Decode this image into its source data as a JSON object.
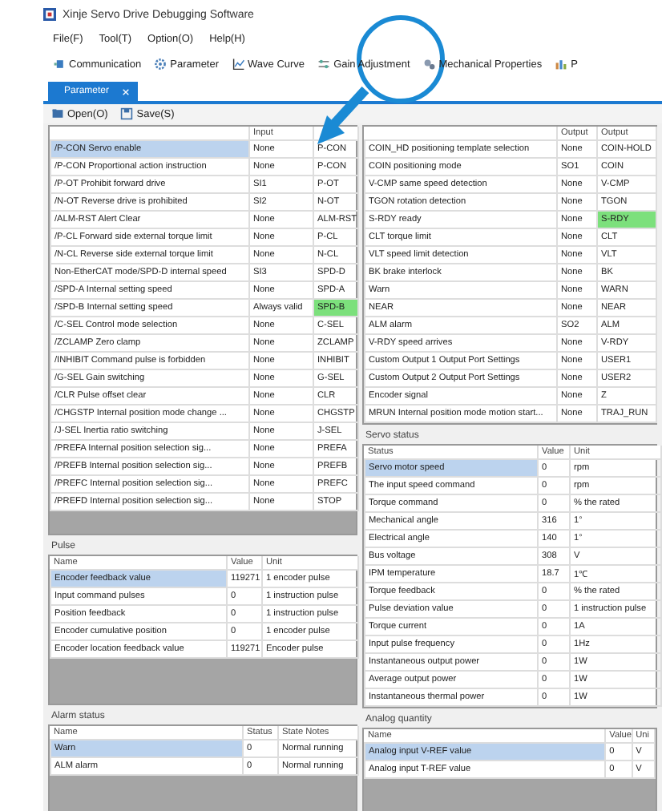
{
  "window": {
    "title": "Xinje Servo Drive Debugging Software"
  },
  "menu": [
    "File(F)",
    "Tool(T)",
    "Option(O)",
    "Help(H)"
  ],
  "toolbar": [
    {
      "kind": "plug",
      "label": "Communication"
    },
    {
      "kind": "gear",
      "label": "Parameter"
    },
    {
      "kind": "wave",
      "label": "Wave Curve"
    },
    {
      "kind": "tune",
      "label": "Gain Adjustment"
    },
    {
      "kind": "mech",
      "label": "Mechanical Properties"
    },
    {
      "kind": "bars",
      "label": "P"
    }
  ],
  "tabs": [
    {
      "label": "Parameter",
      "selected": true
    }
  ],
  "actions": [
    {
      "kind": "open",
      "label": "Open(O)"
    },
    {
      "kind": "save",
      "label": "Save(S)"
    }
  ],
  "input_signals": {
    "columns": [
      "",
      "Input",
      ""
    ],
    "rows": [
      {
        "cells": [
          "/P-CON Servo enable",
          "None",
          "P-CON"
        ],
        "selected": true,
        "signal_on": false
      },
      {
        "cells": [
          "/P-CON Proportional action instruction",
          "None",
          "P-CON"
        ],
        "selected": false,
        "signal_on": false
      },
      {
        "cells": [
          "/P-OT Prohibit forward drive",
          "SI1",
          "P-OT"
        ],
        "selected": false,
        "signal_on": false
      },
      {
        "cells": [
          "/N-OT Reverse drive is prohibited",
          "SI2",
          "N-OT"
        ],
        "selected": false,
        "signal_on": false
      },
      {
        "cells": [
          "/ALM-RST Alert Clear",
          "None",
          "ALM-RST"
        ],
        "selected": false,
        "signal_on": false
      },
      {
        "cells": [
          "/P-CL Forward side external torque limit",
          "None",
          "P-CL"
        ],
        "selected": false,
        "signal_on": false
      },
      {
        "cells": [
          "/N-CL Reverse side external torque limit",
          "None",
          "N-CL"
        ],
        "selected": false,
        "signal_on": false
      },
      {
        "cells": [
          "Non-EtherCAT mode/SPD-D internal speed",
          "SI3",
          "SPD-D"
        ],
        "selected": false,
        "signal_on": false
      },
      {
        "cells": [
          "/SPD-A Internal setting speed",
          "None",
          "SPD-A"
        ],
        "selected": false,
        "signal_on": false
      },
      {
        "cells": [
          "/SPD-B Internal setting speed",
          "Always valid",
          "SPD-B"
        ],
        "selected": false,
        "signal_on": true
      },
      {
        "cells": [
          "/C-SEL Control mode selection",
          "None",
          "C-SEL"
        ],
        "selected": false,
        "signal_on": false
      },
      {
        "cells": [
          "/ZCLAMP Zero clamp",
          "None",
          "ZCLAMP"
        ],
        "selected": false,
        "signal_on": false
      },
      {
        "cells": [
          "/INHIBIT Command pulse is forbidden",
          "None",
          "INHIBIT"
        ],
        "selected": false,
        "signal_on": false
      },
      {
        "cells": [
          "/G-SEL Gain switching",
          "None",
          "G-SEL"
        ],
        "selected": false,
        "signal_on": false
      },
      {
        "cells": [
          "/CLR Pulse offset clear",
          "None",
          "CLR"
        ],
        "selected": false,
        "signal_on": false
      },
      {
        "cells": [
          "/CHGSTP Internal position mode change ...",
          "None",
          "CHGSTP"
        ],
        "selected": false,
        "signal_on": false
      },
      {
        "cells": [
          "/J-SEL Inertia ratio switching",
          "None",
          "J-SEL"
        ],
        "selected": false,
        "signal_on": false
      },
      {
        "cells": [
          "/PREFA Internal position selection sig...",
          "None",
          "PREFA"
        ],
        "selected": false,
        "signal_on": false
      },
      {
        "cells": [
          "/PREFB Internal position selection sig...",
          "None",
          "PREFB"
        ],
        "selected": false,
        "signal_on": false
      },
      {
        "cells": [
          "/PREFC Internal position selection sig...",
          "None",
          "PREFC"
        ],
        "selected": false,
        "signal_on": false
      },
      {
        "cells": [
          "/PREFD Internal position selection sig...",
          "None",
          "STOP"
        ],
        "selected": false,
        "signal_on": false
      }
    ]
  },
  "output_signals": {
    "columns": [
      "",
      "Output",
      "Output"
    ],
    "rows": [
      {
        "cells": [
          "COIN_HD positioning template selection",
          "None",
          "COIN-HOLD"
        ],
        "selected": false,
        "signal_on": false
      },
      {
        "cells": [
          "COIN positioning mode",
          "SO1",
          "COIN"
        ],
        "selected": false,
        "signal_on": false
      },
      {
        "cells": [
          "V-CMP same speed detection",
          "None",
          "V-CMP"
        ],
        "selected": false,
        "signal_on": false
      },
      {
        "cells": [
          "TGON rotation detection",
          "None",
          "TGON"
        ],
        "selected": false,
        "signal_on": false
      },
      {
        "cells": [
          "S-RDY ready",
          "None",
          "S-RDY"
        ],
        "selected": false,
        "signal_on": true
      },
      {
        "cells": [
          "CLT torque limit",
          "None",
          "CLT"
        ],
        "selected": false,
        "signal_on": false
      },
      {
        "cells": [
          "VLT speed limit detection",
          "None",
          "VLT"
        ],
        "selected": false,
        "signal_on": false
      },
      {
        "cells": [
          "BK brake interlock",
          "None",
          "BK"
        ],
        "selected": false,
        "signal_on": false
      },
      {
        "cells": [
          "Warn",
          "None",
          "WARN"
        ],
        "selected": false,
        "signal_on": false
      },
      {
        "cells": [
          "NEAR",
          "None",
          "NEAR"
        ],
        "selected": false,
        "signal_on": false
      },
      {
        "cells": [
          "ALM alarm",
          "SO2",
          "ALM"
        ],
        "selected": false,
        "signal_on": false
      },
      {
        "cells": [
          "V-RDY speed arrives",
          "None",
          "V-RDY"
        ],
        "selected": false,
        "signal_on": false
      },
      {
        "cells": [
          "Custom Output 1 Output Port Settings",
          "None",
          "USER1"
        ],
        "selected": false,
        "signal_on": false
      },
      {
        "cells": [
          "Custom Output 2 Output Port Settings",
          "None",
          "USER2"
        ],
        "selected": false,
        "signal_on": false
      },
      {
        "cells": [
          "Encoder signal",
          "None",
          "Z"
        ],
        "selected": false,
        "signal_on": false
      },
      {
        "cells": [
          "MRUN Internal position mode motion start...",
          "None",
          "TRAJ_RUN"
        ],
        "selected": false,
        "signal_on": false
      }
    ]
  },
  "servo_status": {
    "label": "Servo status",
    "columns": [
      "Status",
      "Value",
      "Unit"
    ],
    "rows": [
      {
        "cells": [
          "Servo motor speed",
          "0",
          "rpm"
        ],
        "selected": true
      },
      {
        "cells": [
          "The input speed command",
          "0",
          "rpm"
        ],
        "selected": false
      },
      {
        "cells": [
          "Torque command",
          "0",
          "% the rated"
        ],
        "selected": false
      },
      {
        "cells": [
          "Mechanical angle",
          "316",
          "1°"
        ],
        "selected": false
      },
      {
        "cells": [
          "Electrical angle",
          "140",
          "1°"
        ],
        "selected": false
      },
      {
        "cells": [
          "Bus voltage",
          "308",
          "V"
        ],
        "selected": false
      },
      {
        "cells": [
          "IPM temperature",
          "18.7",
          "1℃"
        ],
        "selected": false
      },
      {
        "cells": [
          "Torque feedback",
          "0",
          "% the rated"
        ],
        "selected": false
      },
      {
        "cells": [
          "Pulse deviation value",
          "0",
          "1 instruction pulse"
        ],
        "selected": false
      },
      {
        "cells": [
          "Torque current",
          "0",
          "1A"
        ],
        "selected": false
      },
      {
        "cells": [
          "Input pulse frequency",
          "0",
          "1Hz"
        ],
        "selected": false
      },
      {
        "cells": [
          "Instantaneous output power",
          "0",
          "1W"
        ],
        "selected": false
      },
      {
        "cells": [
          "Average output power",
          "0",
          "1W"
        ],
        "selected": false
      },
      {
        "cells": [
          "Instantaneous thermal power",
          "0",
          "1W"
        ],
        "selected": false
      }
    ]
  },
  "pulse": {
    "label": "Pulse",
    "columns": [
      "Name",
      "Value",
      "Unit"
    ],
    "rows": [
      {
        "cells": [
          "Encoder feedback value",
          "119271",
          "1 encoder pulse"
        ],
        "selected": true
      },
      {
        "cells": [
          "Input command pulses",
          "0",
          "1 instruction pulse"
        ],
        "selected": false
      },
      {
        "cells": [
          "Position feedback",
          "0",
          "1 instruction pulse"
        ],
        "selected": false
      },
      {
        "cells": [
          "Encoder cumulative position",
          "0",
          "1 encoder pulse"
        ],
        "selected": false
      },
      {
        "cells": [
          "Encoder location feedback value",
          "119271",
          "Encoder pulse"
        ],
        "selected": false
      }
    ]
  },
  "alarm_status": {
    "label": "Alarm status",
    "columns": [
      "Name",
      "Status",
      "State Notes"
    ],
    "rows": [
      {
        "cells": [
          "Warn",
          "0",
          "Normal running"
        ],
        "selected": true
      },
      {
        "cells": [
          "ALM alarm",
          "0",
          "Normal running"
        ],
        "selected": false
      }
    ]
  },
  "analog_quantity": {
    "label": "Analog quantity",
    "columns": [
      "Name",
      "Value",
      "Uni"
    ],
    "rows": [
      {
        "cells": [
          "Analog input V-REF value",
          "0",
          "V"
        ],
        "selected": true
      },
      {
        "cells": [
          "Analog input T-REF value",
          "0",
          "V"
        ],
        "selected": false
      }
    ]
  }
}
